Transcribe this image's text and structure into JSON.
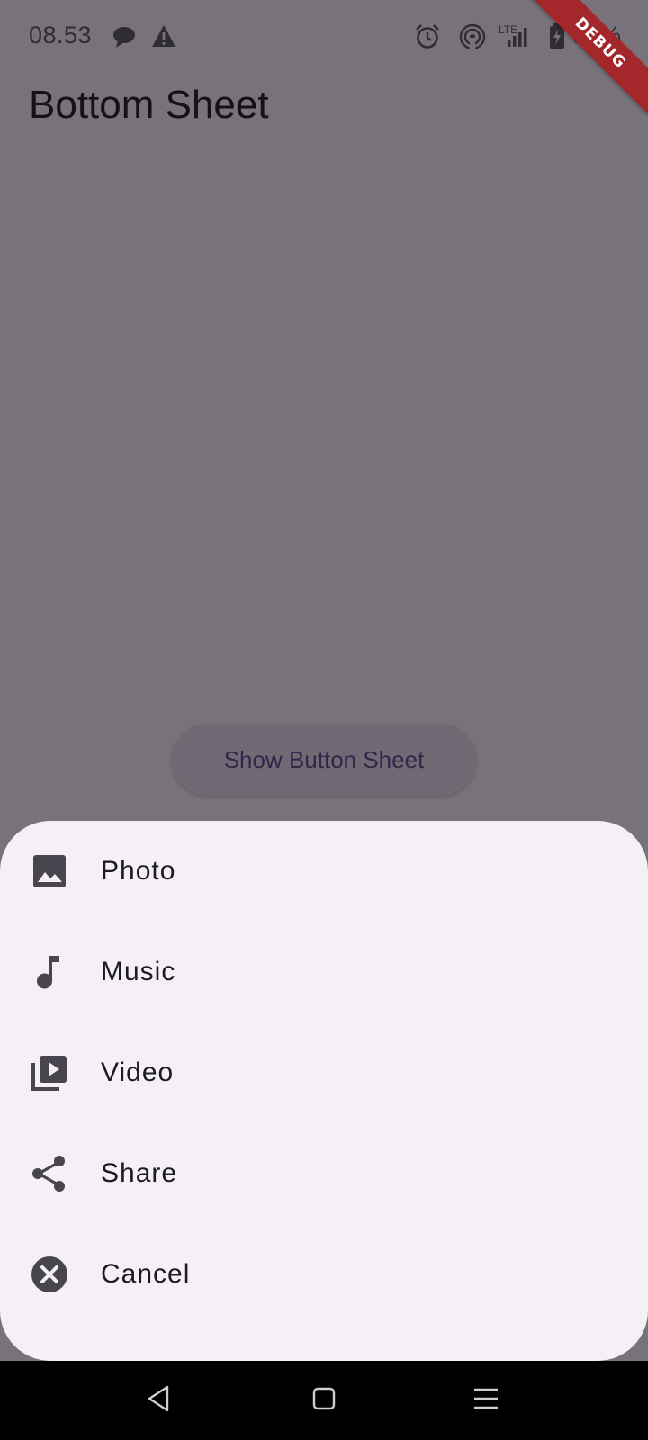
{
  "status_bar": {
    "time": "08.53",
    "battery_text": "95%",
    "network_label": "LTE",
    "icons": [
      "chat-bubble-icon",
      "warning-icon",
      "alarm-icon",
      "hotspot-icon",
      "signal-icon",
      "battery-charging-icon"
    ]
  },
  "debug_banner": {
    "label": "DEBUG"
  },
  "app_bar": {
    "title": "Bottom Sheet"
  },
  "main": {
    "show_button_label": "Show Button Sheet"
  },
  "bottom_sheet": {
    "items": [
      {
        "label": "Photo",
        "icon": "photo-icon"
      },
      {
        "label": "Music",
        "icon": "music-note-icon"
      },
      {
        "label": "Video",
        "icon": "video-library-icon"
      },
      {
        "label": "Share",
        "icon": "share-icon"
      },
      {
        "label": "Cancel",
        "icon": "cancel-icon"
      }
    ]
  },
  "nav_bar": {
    "buttons": [
      "back-icon",
      "home-icon",
      "menu-icon"
    ]
  },
  "colors": {
    "scrim": "#78737a",
    "sheet": "#f4f0f6",
    "button_text": "#31274b",
    "debug_banner": "#a4282b",
    "icon": "#49454f"
  }
}
